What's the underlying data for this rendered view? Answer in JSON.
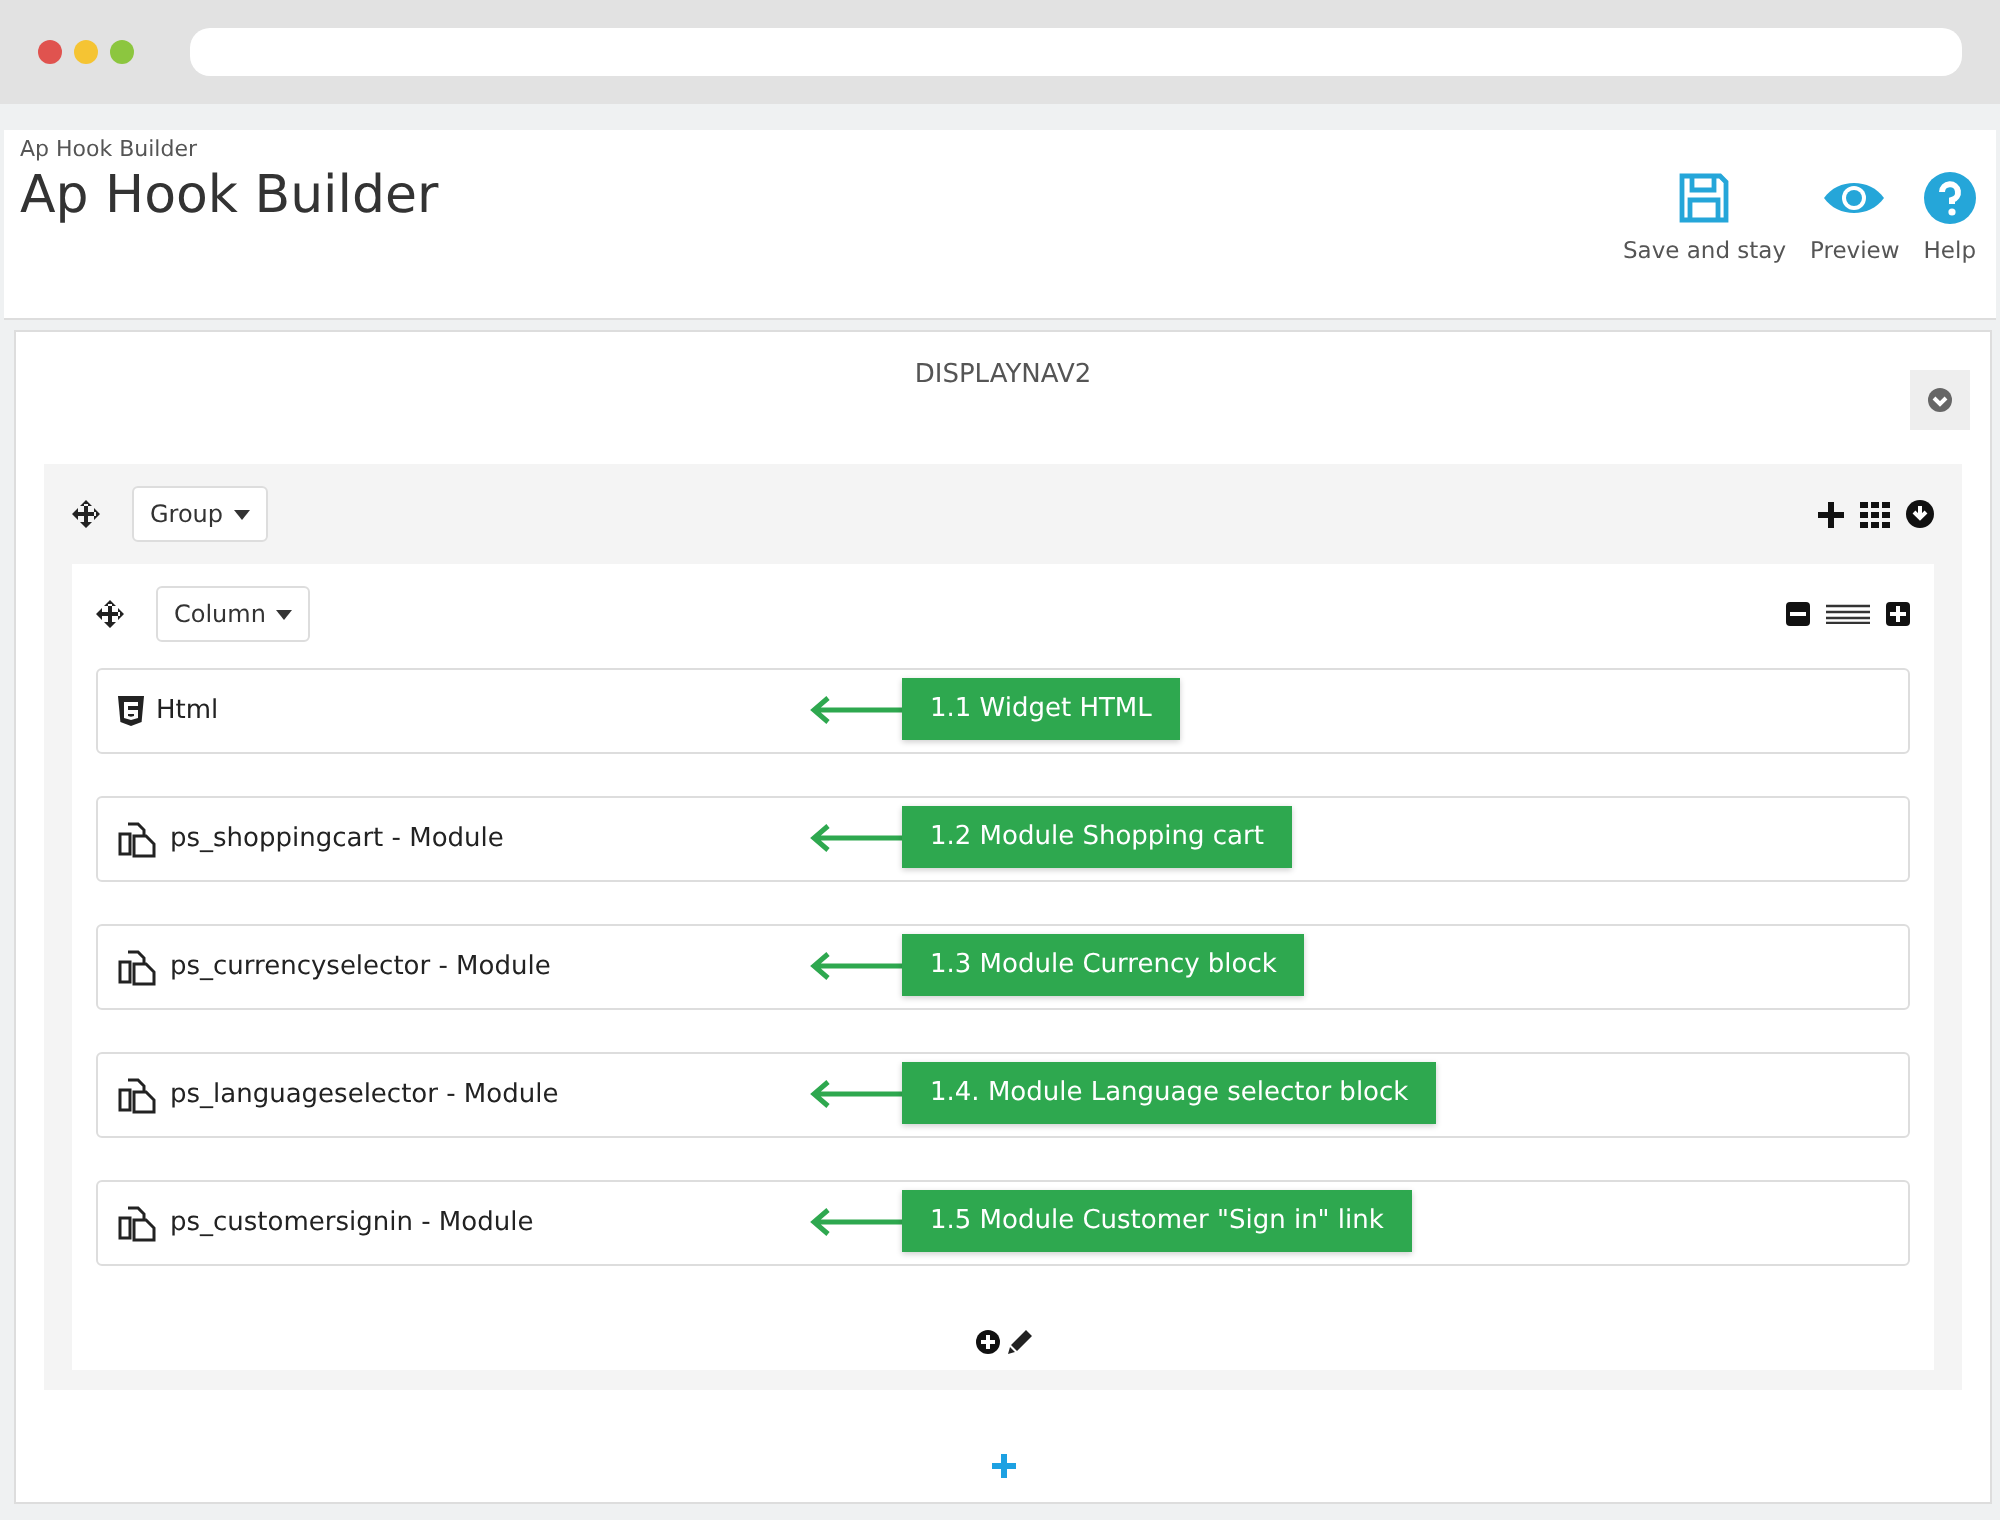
{
  "breadcrumb": "Ap Hook Builder",
  "title": "Ap Hook Builder",
  "toolbar": [
    {
      "kind": "save",
      "label": "Save and stay"
    },
    {
      "kind": "preview",
      "label": "Preview"
    },
    {
      "kind": "help",
      "label": "Help"
    }
  ],
  "hook": {
    "name": "DISPLAYNAV2"
  },
  "group": {
    "label": "Group"
  },
  "column": {
    "label": "Column"
  },
  "widgets": [
    {
      "kind": "html",
      "label": "Html",
      "callout": "1.1 Widget HTML"
    },
    {
      "kind": "module",
      "label": "ps_shoppingcart - Module",
      "callout": "1.2 Module Shopping cart"
    },
    {
      "kind": "module",
      "label": "ps_currencyselector - Module",
      "callout": "1.3 Module Currency block"
    },
    {
      "kind": "module",
      "label": "ps_languageselector - Module",
      "callout": "1.4. Module Language selector block"
    },
    {
      "kind": "module",
      "label": "ps_customersignin - Module",
      "callout": "1.5 Module Customer \"Sign in\" link"
    }
  ]
}
